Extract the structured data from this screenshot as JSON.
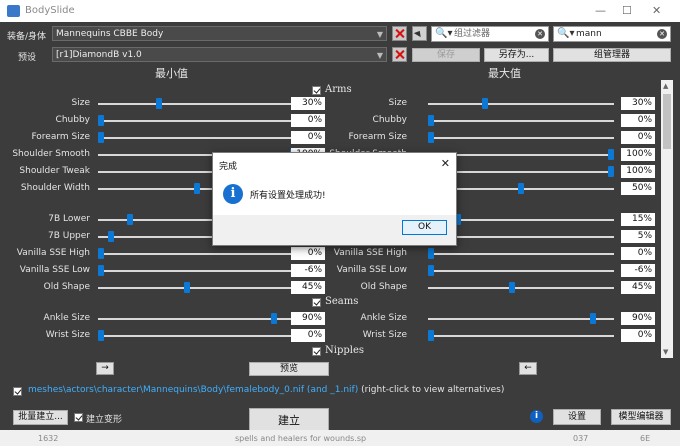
{
  "window": {
    "title": "BodySlide",
    "controls": {
      "minimize": "—",
      "maximize": "☐",
      "close": "✕"
    }
  },
  "top": {
    "outfit_label": "装备/身体",
    "outfit_value": "Mannequins CBBE Body",
    "preset_label": "预设",
    "preset_value": "[r1]DiamondB v1.0",
    "group_filter_placeholder": "组过滤器",
    "outfit_filter_value": "mann",
    "save_label": "保存",
    "save_as_label": "另存为...",
    "group_manager_label": "组管理器"
  },
  "columns": {
    "min": "最小值",
    "max": "最大值"
  },
  "groups": {
    "arms": "Arms",
    "seams": "Seams",
    "nipples": "Nipples"
  },
  "sliders": [
    {
      "label": "Size",
      "min": "30%",
      "max": "30%",
      "min_pos": 0.3,
      "max_pos": 0.3
    },
    {
      "label": "Chubby",
      "min": "0%",
      "max": "0%",
      "min_pos": 0,
      "max_pos": 0
    },
    {
      "label": "Forearm Size",
      "min": "0%",
      "max": "0%",
      "min_pos": 0,
      "max_pos": 0
    },
    {
      "label": "Shoulder Smooth",
      "min": "100%",
      "max": "100%",
      "min_pos": 1,
      "max_pos": 1
    },
    {
      "label": "Shoulder Tweak",
      "min": "100%",
      "max": "100%",
      "min_pos": 1,
      "max_pos": 1
    },
    {
      "label": "Shoulder Width",
      "min": "50%",
      "max": "50%",
      "min_pos": 0.5,
      "max_pos": 0.5
    },
    {
      "label": "7B Lower",
      "min": "15%",
      "max": "15%",
      "min_pos": 0.15,
      "max_pos": 0.15
    },
    {
      "label": "7B Upper",
      "min": "5%",
      "max": "5%",
      "min_pos": 0.05,
      "max_pos": 0.05
    },
    {
      "label": "Vanilla SSE High",
      "min": "0%",
      "max": "0%",
      "min_pos": 0,
      "max_pos": 0
    },
    {
      "label": "Vanilla SSE Low",
      "min": "-6%",
      "max": "-6%",
      "min_pos": 0,
      "max_pos": 0
    },
    {
      "label": "Old Shape",
      "min": "45%",
      "max": "45%",
      "min_pos": 0.45,
      "max_pos": 0.45
    },
    {
      "label": "Ankle Size",
      "min": "90%",
      "max": "90%",
      "min_pos": 0.9,
      "max_pos": 0.9
    },
    {
      "label": "Wrist Size",
      "min": "0%",
      "max": "0%",
      "min_pos": 0,
      "max_pos": 0
    }
  ],
  "bottom": {
    "preview_label": "预览",
    "path": "meshes\\actors\\character\\Mannequins\\Body\\femalebody_0.nif (and _1.nif)",
    "path_hint": "(right-click to view alternatives)",
    "batch_build_label": "批量建立...",
    "build_morphs_label": "建立变形",
    "build_label": "建立",
    "settings_label": "设置",
    "outfit_studio_label": "模型编辑器"
  },
  "dialog": {
    "title": "完成",
    "message": "所有设置处理成功!",
    "ok_label": "OK"
  },
  "background_strip": {
    "left": "1632",
    "mid": "spells and healers for wounds.sp",
    "right1": "037",
    "right2": "6E"
  }
}
